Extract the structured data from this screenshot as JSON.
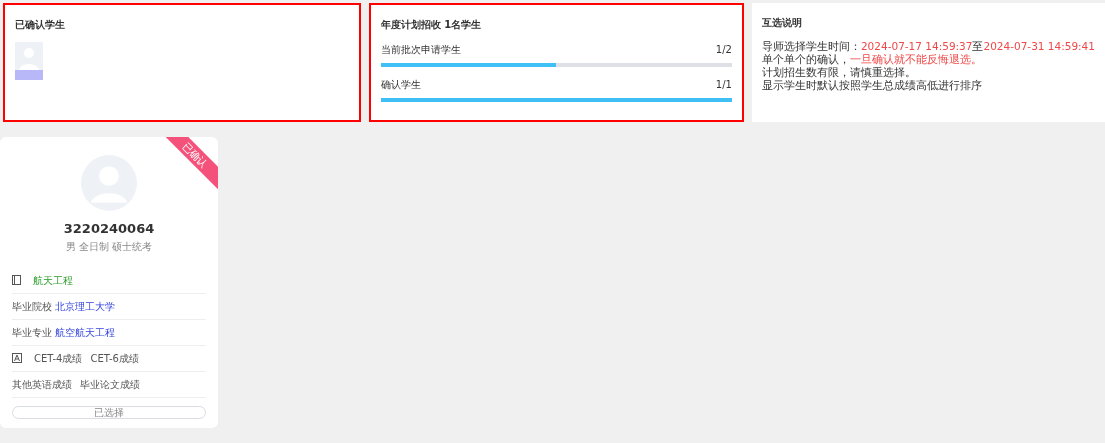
{
  "confirmed_panel": {
    "title": "已确认学生"
  },
  "plan_panel": {
    "title": "年度计划招收 1名学生",
    "progress": [
      {
        "label": "当前批次申请学生",
        "reading": "1/2",
        "level": 0.5
      },
      {
        "label": "确认学生",
        "reading": "1/1",
        "level": 1
      }
    ]
  },
  "notes_panel": {
    "title": "互选说明",
    "lines": [
      [
        {
          "text": "导师选择学生时间：",
          "highlight": false
        },
        {
          "text": "2024-07-17 14:59:37",
          "highlight": true
        },
        {
          "text": "至",
          "highlight": false
        },
        {
          "text": "2024-07-31 14:59:41",
          "highlight": true
        }
      ],
      [
        {
          "text": "单个单个的确认，",
          "highlight": false
        },
        {
          "text": "一旦确认就不能反悔退选。",
          "highlight": true
        }
      ],
      [
        {
          "text": "计划招生数有限，请慎重选择。",
          "highlight": false
        }
      ],
      [
        {
          "text": "显示学生时默认按照学生总成绩高低进行排序",
          "highlight": false
        }
      ]
    ]
  },
  "student_card": {
    "ribbon": "已确认",
    "id": "3220240064",
    "meta": "男 全日制 硕士统考",
    "rows": [
      {
        "kind": "specialty",
        "value": "航天工程"
      },
      {
        "kind": "field",
        "label": "毕业院校",
        "value": "北京理工大学"
      },
      {
        "kind": "field",
        "label": "毕业专业",
        "value": "航空航天工程"
      },
      {
        "kind": "scores-icon",
        "items": [
          "CET-4成绩",
          "CET-6成绩"
        ]
      },
      {
        "kind": "scores",
        "items": [
          "其他英语成绩",
          "毕业论文成绩"
        ]
      }
    ],
    "button": {
      "label": "已选择",
      "disabled": true
    }
  }
}
